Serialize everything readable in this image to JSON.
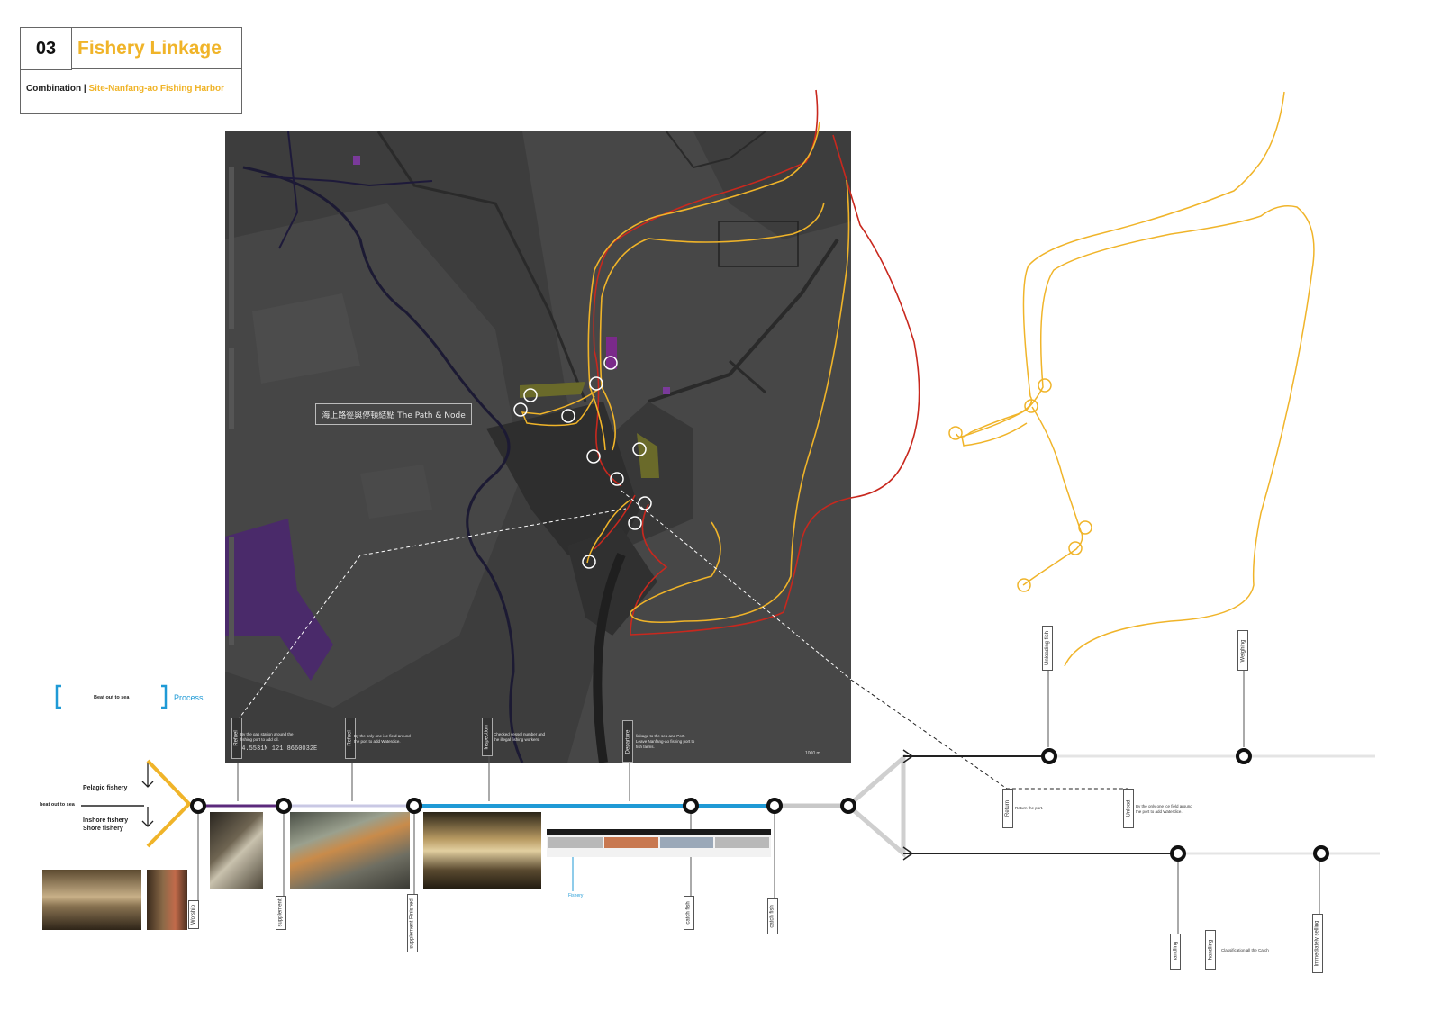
{
  "header": {
    "number": "03",
    "title": "Fishery Linkage",
    "subtitle_prefix": "Combination | ",
    "subtitle_site": "Site-Nanfang-ao Fishing Harbor"
  },
  "map": {
    "caption": "海上路徑與停頓結點 The Path & Node",
    "coords": "24.5531N 121.8660032E",
    "scale_label": "1000 m"
  },
  "process_key": {
    "bracket_text": "Beat out to sea",
    "label": "Process"
  },
  "branch": {
    "left_label": "beat out to sea",
    "upper_label": "Pelagic fishery",
    "lower_label_1": "Inshore fishery",
    "lower_label_2": "Shore fishery"
  },
  "map_tags": [
    {
      "label": "Refuel",
      "note": "By the gas station around the fishing port to add oil."
    },
    {
      "label": "Refuel",
      "note": "By the only one ice field around the port to add Waterdice."
    },
    {
      "label": "Inspection",
      "note": "Checked vessel number and the illegal fishing workers."
    },
    {
      "label": "Departure",
      "note": "linkage to the sea and Port. Leave Nanfang-ao fishing port to fish farms."
    }
  ],
  "timeline_tags": [
    {
      "label": "Worship"
    },
    {
      "label": "supplement"
    },
    {
      "label": "supplement Finished"
    },
    {
      "label": "catch fish"
    },
    {
      "label": "catch fish"
    }
  ],
  "upper_branch_tags": [
    {
      "label": "Unloading fish"
    },
    {
      "label": "Weighing"
    }
  ],
  "lower_branch_tags": [
    {
      "label": "handling"
    },
    {
      "label": "handling"
    },
    {
      "label": "Immediately selling"
    }
  ],
  "middle_tags": [
    {
      "label": "Return",
      "note": "Return the port."
    },
    {
      "label": "Unload",
      "note": "By the only one ice field around the port to add Waterdice."
    }
  ],
  "classification_note": "Classification all the Catch",
  "fishery_label": "Fishery",
  "colors": {
    "accent_orange": "#f0b429",
    "route_red": "#c8281e",
    "process_blue": "#1f9ad6",
    "purple": "#5b2a7c"
  }
}
